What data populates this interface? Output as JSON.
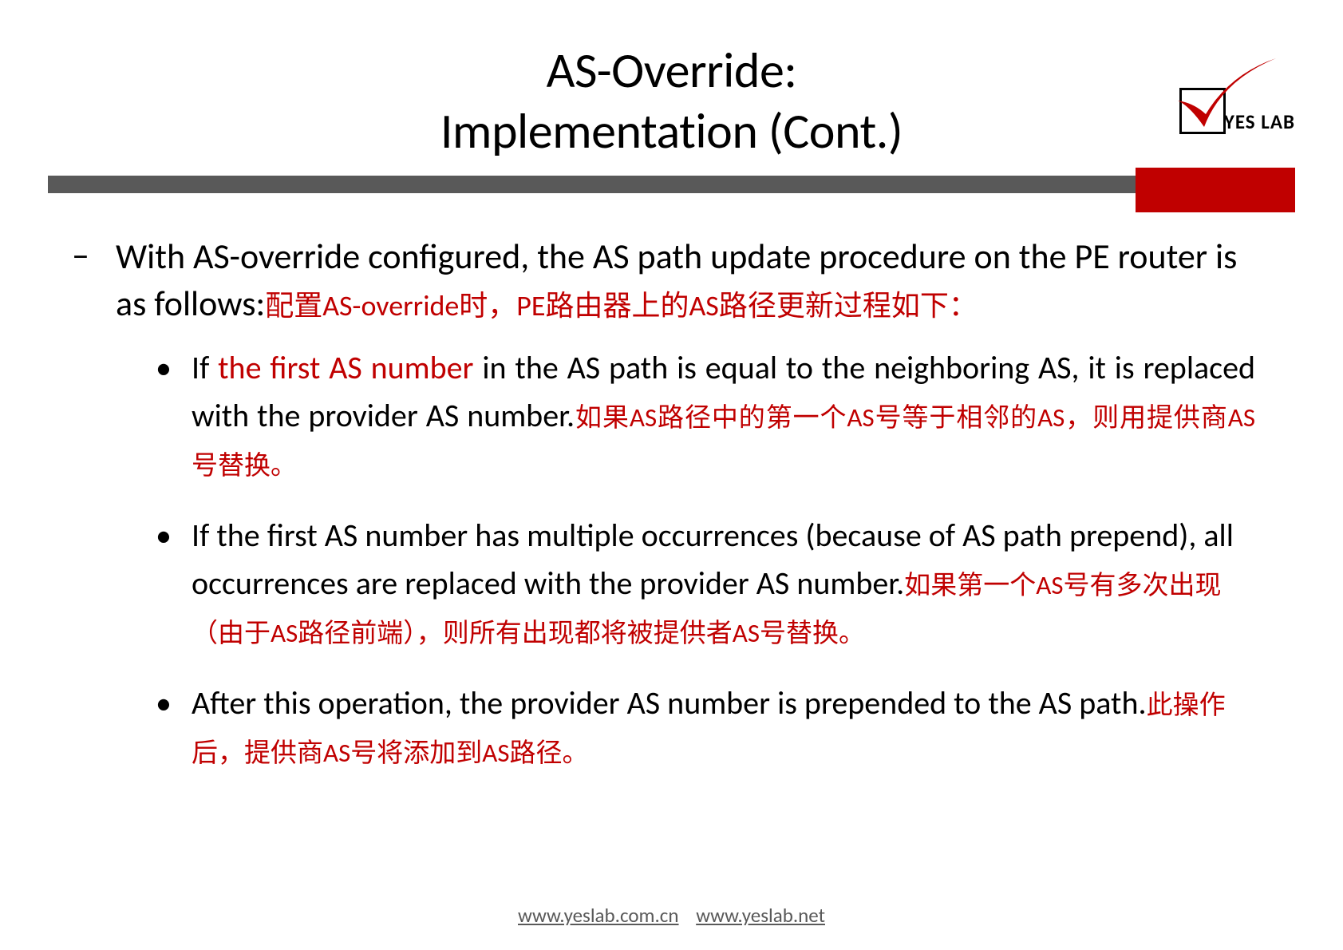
{
  "title": {
    "line1": "AS-Override:",
    "line2": "Implementation (Cont.)"
  },
  "logo": {
    "text": "YES LAB",
    "icon_name": "checkmark-logo-icon",
    "check_color": "#c00000"
  },
  "content": {
    "intro_en": "With AS-override configured, the AS path  update procedure on the PE router is as follows:",
    "intro_zh": "配置AS-override时，PE路由器上的AS路径更新过程如下：",
    "bullets": [
      {
        "en_prefix": "If ",
        "en_highlight": "the first AS number",
        "en_rest": " in the AS path is equal to the  neighboring AS, it is replaced with the provider AS  number.",
        "zh": "如果AS路径中的第一个AS号等于相邻的AS，则用提供商AS号替换。"
      },
      {
        "en_full": "If the first AS number has multiple occurrences  (because of AS path prepend), all occurrences are  replaced with the provider AS number.",
        "zh": "如果第一个AS号有多次出现（由于AS路径前端），则所有出现都将被提供者AS号替换。"
      },
      {
        "en_full": "After this operation, the provider AS number is prepended to the AS path.",
        "zh": "此操作后，提供商AS号将添加到AS路径。"
      }
    ]
  },
  "footer": {
    "link1": "www.yeslab.com.cn",
    "link2": "www.yeslab.net"
  }
}
